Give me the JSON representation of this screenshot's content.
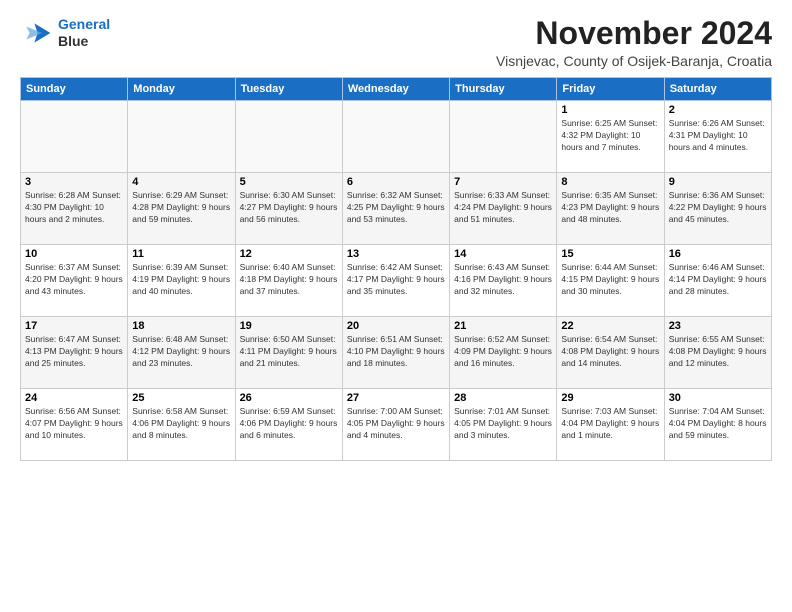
{
  "header": {
    "logo_line1": "General",
    "logo_line2": "Blue",
    "month": "November 2024",
    "location": "Visnjevac, County of Osijek-Baranja, Croatia"
  },
  "weekdays": [
    "Sunday",
    "Monday",
    "Tuesday",
    "Wednesday",
    "Thursday",
    "Friday",
    "Saturday"
  ],
  "weeks": [
    [
      {
        "day": "",
        "info": ""
      },
      {
        "day": "",
        "info": ""
      },
      {
        "day": "",
        "info": ""
      },
      {
        "day": "",
        "info": ""
      },
      {
        "day": "",
        "info": ""
      },
      {
        "day": "1",
        "info": "Sunrise: 6:25 AM\nSunset: 4:32 PM\nDaylight: 10 hours\nand 7 minutes."
      },
      {
        "day": "2",
        "info": "Sunrise: 6:26 AM\nSunset: 4:31 PM\nDaylight: 10 hours\nand 4 minutes."
      }
    ],
    [
      {
        "day": "3",
        "info": "Sunrise: 6:28 AM\nSunset: 4:30 PM\nDaylight: 10 hours\nand 2 minutes."
      },
      {
        "day": "4",
        "info": "Sunrise: 6:29 AM\nSunset: 4:28 PM\nDaylight: 9 hours\nand 59 minutes."
      },
      {
        "day": "5",
        "info": "Sunrise: 6:30 AM\nSunset: 4:27 PM\nDaylight: 9 hours\nand 56 minutes."
      },
      {
        "day": "6",
        "info": "Sunrise: 6:32 AM\nSunset: 4:25 PM\nDaylight: 9 hours\nand 53 minutes."
      },
      {
        "day": "7",
        "info": "Sunrise: 6:33 AM\nSunset: 4:24 PM\nDaylight: 9 hours\nand 51 minutes."
      },
      {
        "day": "8",
        "info": "Sunrise: 6:35 AM\nSunset: 4:23 PM\nDaylight: 9 hours\nand 48 minutes."
      },
      {
        "day": "9",
        "info": "Sunrise: 6:36 AM\nSunset: 4:22 PM\nDaylight: 9 hours\nand 45 minutes."
      }
    ],
    [
      {
        "day": "10",
        "info": "Sunrise: 6:37 AM\nSunset: 4:20 PM\nDaylight: 9 hours\nand 43 minutes."
      },
      {
        "day": "11",
        "info": "Sunrise: 6:39 AM\nSunset: 4:19 PM\nDaylight: 9 hours\nand 40 minutes."
      },
      {
        "day": "12",
        "info": "Sunrise: 6:40 AM\nSunset: 4:18 PM\nDaylight: 9 hours\nand 37 minutes."
      },
      {
        "day": "13",
        "info": "Sunrise: 6:42 AM\nSunset: 4:17 PM\nDaylight: 9 hours\nand 35 minutes."
      },
      {
        "day": "14",
        "info": "Sunrise: 6:43 AM\nSunset: 4:16 PM\nDaylight: 9 hours\nand 32 minutes."
      },
      {
        "day": "15",
        "info": "Sunrise: 6:44 AM\nSunset: 4:15 PM\nDaylight: 9 hours\nand 30 minutes."
      },
      {
        "day": "16",
        "info": "Sunrise: 6:46 AM\nSunset: 4:14 PM\nDaylight: 9 hours\nand 28 minutes."
      }
    ],
    [
      {
        "day": "17",
        "info": "Sunrise: 6:47 AM\nSunset: 4:13 PM\nDaylight: 9 hours\nand 25 minutes."
      },
      {
        "day": "18",
        "info": "Sunrise: 6:48 AM\nSunset: 4:12 PM\nDaylight: 9 hours\nand 23 minutes."
      },
      {
        "day": "19",
        "info": "Sunrise: 6:50 AM\nSunset: 4:11 PM\nDaylight: 9 hours\nand 21 minutes."
      },
      {
        "day": "20",
        "info": "Sunrise: 6:51 AM\nSunset: 4:10 PM\nDaylight: 9 hours\nand 18 minutes."
      },
      {
        "day": "21",
        "info": "Sunrise: 6:52 AM\nSunset: 4:09 PM\nDaylight: 9 hours\nand 16 minutes."
      },
      {
        "day": "22",
        "info": "Sunrise: 6:54 AM\nSunset: 4:08 PM\nDaylight: 9 hours\nand 14 minutes."
      },
      {
        "day": "23",
        "info": "Sunrise: 6:55 AM\nSunset: 4:08 PM\nDaylight: 9 hours\nand 12 minutes."
      }
    ],
    [
      {
        "day": "24",
        "info": "Sunrise: 6:56 AM\nSunset: 4:07 PM\nDaylight: 9 hours\nand 10 minutes."
      },
      {
        "day": "25",
        "info": "Sunrise: 6:58 AM\nSunset: 4:06 PM\nDaylight: 9 hours\nand 8 minutes."
      },
      {
        "day": "26",
        "info": "Sunrise: 6:59 AM\nSunset: 4:06 PM\nDaylight: 9 hours\nand 6 minutes."
      },
      {
        "day": "27",
        "info": "Sunrise: 7:00 AM\nSunset: 4:05 PM\nDaylight: 9 hours\nand 4 minutes."
      },
      {
        "day": "28",
        "info": "Sunrise: 7:01 AM\nSunset: 4:05 PM\nDaylight: 9 hours\nand 3 minutes."
      },
      {
        "day": "29",
        "info": "Sunrise: 7:03 AM\nSunset: 4:04 PM\nDaylight: 9 hours\nand 1 minute."
      },
      {
        "day": "30",
        "info": "Sunrise: 7:04 AM\nSunset: 4:04 PM\nDaylight: 8 hours\nand 59 minutes."
      }
    ]
  ]
}
